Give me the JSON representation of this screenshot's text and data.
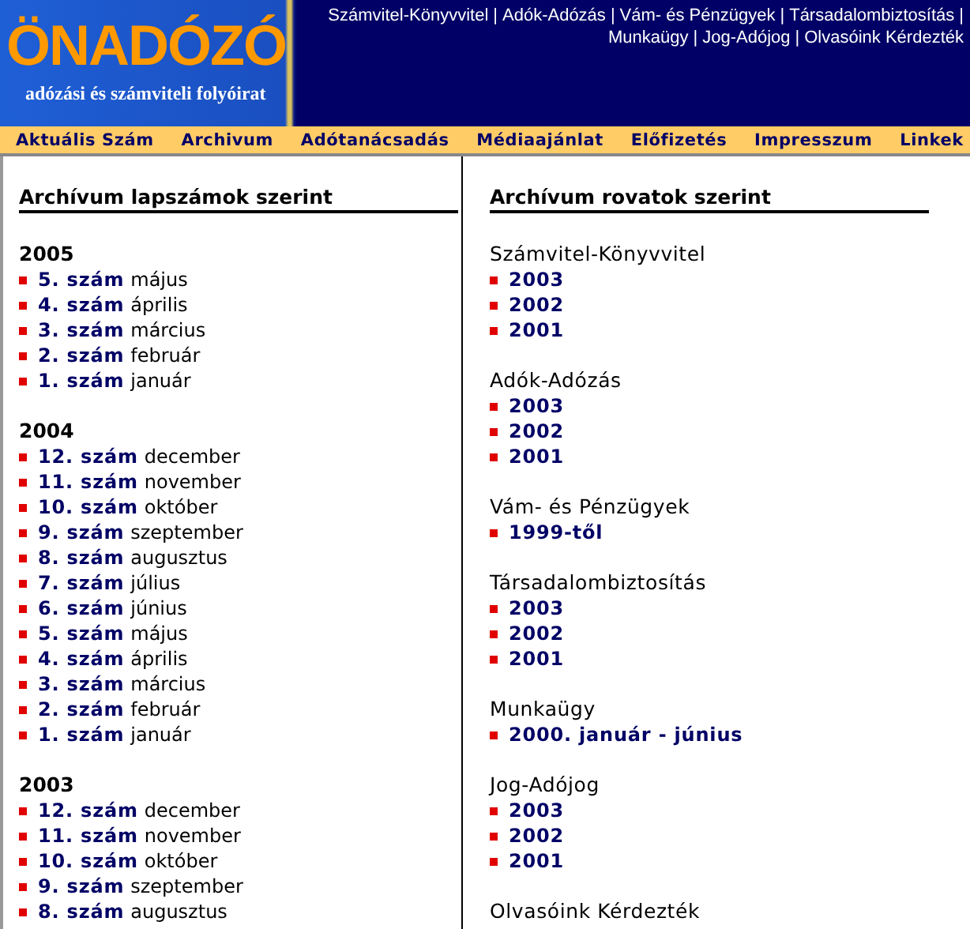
{
  "logo": {
    "title": "ÖNADÓZÓ",
    "subtitle": "adózási és számviteli folyóirat"
  },
  "top_links": {
    "separator": "|",
    "lines": [
      {
        "links": [
          "Számvitel-Könyvvitel",
          "Adók-Adózás",
          "Vám- és Pénzügyek",
          "Társadalombiztosítás"
        ],
        "end": "|"
      },
      {
        "links": [
          "Munkaügy",
          "Jog-Adójog",
          "Olvasóink Kérdezték"
        ]
      }
    ]
  },
  "nav": [
    "Aktuális Szám",
    "Archivum",
    "Adótanácsadás",
    "Médiaajánlat",
    "Előfizetés",
    "Impresszum",
    "Linkek"
  ],
  "left": {
    "heading": "Archívum lapszámok szerint",
    "years": [
      {
        "year": "2005",
        "issues": [
          {
            "number": "5. szám",
            "month": "május"
          },
          {
            "number": "4. szám",
            "month": "április"
          },
          {
            "number": "3. szám",
            "month": "március"
          },
          {
            "number": "2. szám",
            "month": "február"
          },
          {
            "number": "1. szám",
            "month": "január"
          }
        ]
      },
      {
        "year": "2004",
        "issues": [
          {
            "number": "12. szám",
            "month": "december"
          },
          {
            "number": "11. szám",
            "month": "november"
          },
          {
            "number": "10. szám",
            "month": "október"
          },
          {
            "number": "9. szám",
            "month": "szeptember"
          },
          {
            "number": "8. szám",
            "month": "augusztus"
          },
          {
            "number": "7. szám",
            "month": "július"
          },
          {
            "number": "6. szám",
            "month": "június"
          },
          {
            "number": "5. szám",
            "month": "május"
          },
          {
            "number": "4. szám",
            "month": "április"
          },
          {
            "number": "3. szám",
            "month": "március"
          },
          {
            "number": "2. szám",
            "month": "február"
          },
          {
            "number": "1. szám",
            "month": "január"
          }
        ]
      },
      {
        "year": "2003",
        "issues": [
          {
            "number": "12. szám",
            "month": "december"
          },
          {
            "number": "11. szám",
            "month": "november"
          },
          {
            "number": "10. szám",
            "month": "október"
          },
          {
            "number": "9. szám",
            "month": "szeptember"
          },
          {
            "number": "8. szám",
            "month": "augusztus"
          }
        ]
      }
    ]
  },
  "right": {
    "heading": "Archívum rovatok szerint",
    "sections": [
      {
        "title": "Számvitel-Könyvvitel",
        "links": [
          "2003",
          "2002",
          "2001"
        ]
      },
      {
        "title": "Adók-Adózás",
        "links": [
          "2003",
          "2002",
          "2001"
        ]
      },
      {
        "title": "Vám- és Pénzügyek",
        "links": [
          "1999-től"
        ]
      },
      {
        "title": "Társadalombiztosítás",
        "links": [
          "2003",
          "2002",
          "2001"
        ]
      },
      {
        "title": "Munkaügy",
        "links": [
          "2000. január - június"
        ]
      },
      {
        "title": "Jog-Adójog",
        "links": [
          "2003",
          "2002",
          "2001"
        ]
      },
      {
        "title": "Olvasóink Kérdezték"
      }
    ]
  }
}
